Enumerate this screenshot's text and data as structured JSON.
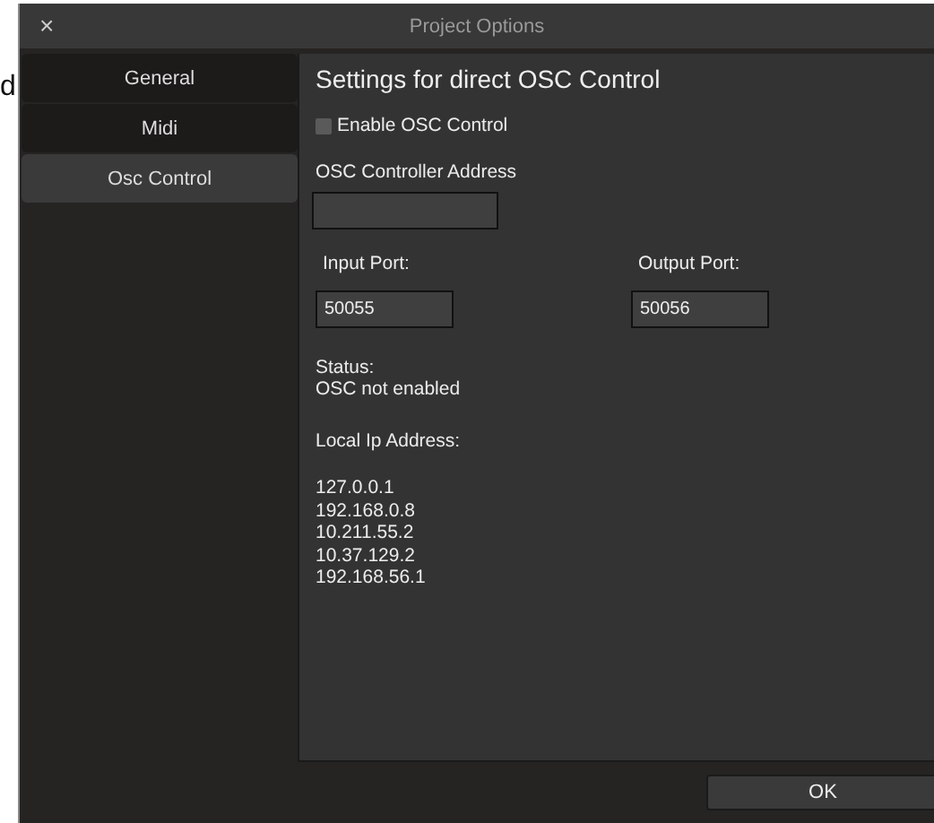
{
  "background_text": "d",
  "window": {
    "title": "Project Options",
    "close": "×"
  },
  "sidebar": {
    "items": [
      {
        "label": "General",
        "selected": false
      },
      {
        "label": "Midi",
        "selected": false
      },
      {
        "label": "Osc Control",
        "selected": true
      }
    ]
  },
  "content": {
    "heading": "Settings for direct OSC Control",
    "enable_checkbox": {
      "label": "Enable OSC Control",
      "checked": false
    },
    "controller_address": {
      "label": "OSC Controller Address"
    },
    "input_port": {
      "label": "Input Port:",
      "value": "50055"
    },
    "output_port": {
      "label": "Output Port:",
      "value": "50056"
    },
    "status_label": "Status:",
    "status": "OSC not enabled",
    "local_ip_label": "Local Ip Address:",
    "ip_addresses": [
      "127.0.0.1",
      "192.168.0.8",
      "10.211.55.2",
      "10.37.129.2",
      "192.168.56.1"
    ]
  },
  "buttons": [
    "OK"
  ]
}
